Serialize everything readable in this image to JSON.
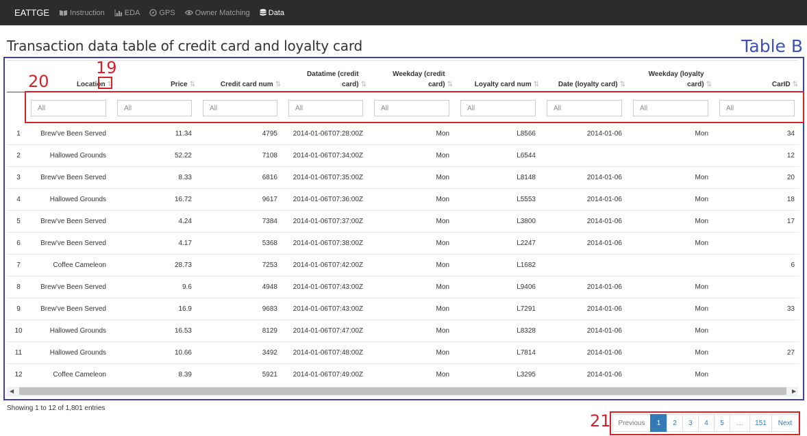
{
  "navbar": {
    "brand": "EATTGE",
    "items": [
      {
        "label": "Instruction",
        "icon": "book-icon",
        "active": false
      },
      {
        "label": "EDA",
        "icon": "bar-chart-icon",
        "active": false
      },
      {
        "label": "GPS",
        "icon": "compass-icon",
        "active": false
      },
      {
        "label": "Owner Matching",
        "icon": "eye-icon",
        "active": false
      },
      {
        "label": "Data",
        "icon": "database-icon",
        "active": true
      }
    ]
  },
  "page": {
    "title": "Transaction data table of credit card and loyalty card",
    "annotation_label": "Table B"
  },
  "table": {
    "columns": [
      {
        "line1": "",
        "line2": "Location"
      },
      {
        "line1": "",
        "line2": "Price"
      },
      {
        "line1": "",
        "line2": "Credit card num"
      },
      {
        "line1": "Datatime (credit",
        "line2": "card)"
      },
      {
        "line1": "Weekday (credit",
        "line2": "card)"
      },
      {
        "line1": "",
        "line2": "Loyalty card num"
      },
      {
        "line1": "",
        "line2": "Date (loyalty card)"
      },
      {
        "line1": "Weekday (loyalty",
        "line2": "card)"
      },
      {
        "line1": "",
        "line2": "CarID"
      }
    ],
    "filter_placeholder": "All",
    "rows": [
      [
        "1",
        "Brew've Been Served",
        "11.34",
        "4795",
        "2014-01-06T07:28:00Z",
        "Mon",
        "L8566",
        "2014-01-06",
        "Mon",
        "34"
      ],
      [
        "2",
        "Hallowed Grounds",
        "52.22",
        "7108",
        "2014-01-06T07:34:00Z",
        "Mon",
        "L6544",
        "",
        "",
        "12"
      ],
      [
        "3",
        "Brew've Been Served",
        "8.33",
        "6816",
        "2014-01-06T07:35:00Z",
        "Mon",
        "L8148",
        "2014-01-06",
        "Mon",
        "20"
      ],
      [
        "4",
        "Hallowed Grounds",
        "16.72",
        "9617",
        "2014-01-06T07:36:00Z",
        "Mon",
        "L5553",
        "2014-01-06",
        "Mon",
        "18"
      ],
      [
        "5",
        "Brew've Been Served",
        "4.24",
        "7384",
        "2014-01-06T07:37:00Z",
        "Mon",
        "L3800",
        "2014-01-06",
        "Mon",
        "17"
      ],
      [
        "6",
        "Brew've Been Served",
        "4.17",
        "5368",
        "2014-01-06T07:38:00Z",
        "Mon",
        "L2247",
        "2014-01-06",
        "Mon",
        ""
      ],
      [
        "7",
        "Coffee Cameleon",
        "28.73",
        "7253",
        "2014-01-06T07:42:00Z",
        "Mon",
        "L1682",
        "",
        "",
        "6"
      ],
      [
        "8",
        "Brew've Been Served",
        "9.6",
        "4948",
        "2014-01-06T07:43:00Z",
        "Mon",
        "L9406",
        "2014-01-06",
        "Mon",
        ""
      ],
      [
        "9",
        "Brew've Been Served",
        "16.9",
        "9683",
        "2014-01-06T07:43:00Z",
        "Mon",
        "L7291",
        "2014-01-06",
        "Mon",
        "33"
      ],
      [
        "10",
        "Hallowed Grounds",
        "16.53",
        "8129",
        "2014-01-06T07:47:00Z",
        "Mon",
        "L8328",
        "2014-01-06",
        "Mon",
        ""
      ],
      [
        "11",
        "Hallowed Grounds",
        "10.66",
        "3492",
        "2014-01-06T07:48:00Z",
        "Mon",
        "L7814",
        "2014-01-06",
        "Mon",
        "27"
      ],
      [
        "12",
        "Coffee Cameleon",
        "8.39",
        "5921",
        "2014-01-06T07:49:00Z",
        "Mon",
        "L3295",
        "2014-01-06",
        "Mon",
        ""
      ]
    ]
  },
  "info": "Showing 1 to 12 of 1,801 entries",
  "pagination": {
    "previous": "Previous",
    "pages": [
      "1",
      "2",
      "3",
      "4",
      "5",
      "…",
      "151"
    ],
    "current": "1",
    "next": "Next"
  },
  "annotations": {
    "sort_marker": "19",
    "filter_marker": "20",
    "pagination_marker": "21"
  },
  "colors": {
    "navbar_bg": "#2c2c2c",
    "annotation_red": "#d8202a",
    "annotation_blue": "#3b4fb5",
    "pager_active": "#337ab7"
  }
}
